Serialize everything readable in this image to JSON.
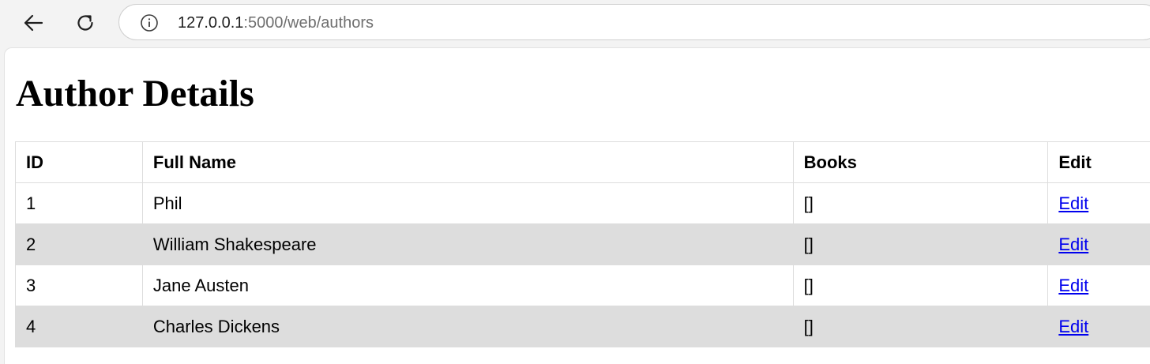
{
  "browser": {
    "url_host": "127.0.0.1",
    "url_rest": ":5000/web/authors"
  },
  "page": {
    "title": "Author Details"
  },
  "table": {
    "headers": [
      "ID",
      "Full Name",
      "Books",
      "Edit"
    ],
    "rows": [
      {
        "id": "1",
        "name": "Phil",
        "books": "[]",
        "edit": "Edit"
      },
      {
        "id": "2",
        "name": "William Shakespeare",
        "books": "[]",
        "edit": "Edit"
      },
      {
        "id": "3",
        "name": "Jane Austen",
        "books": "[]",
        "edit": "Edit"
      },
      {
        "id": "4",
        "name": "Charles Dickens",
        "books": "[]",
        "edit": "Edit"
      }
    ]
  },
  "colors": {
    "link": "#0000ee",
    "striped_row": "#dddddd",
    "border": "#dddddd"
  },
  "icons": [
    "back-arrow-icon",
    "reload-icon",
    "info-icon"
  ]
}
